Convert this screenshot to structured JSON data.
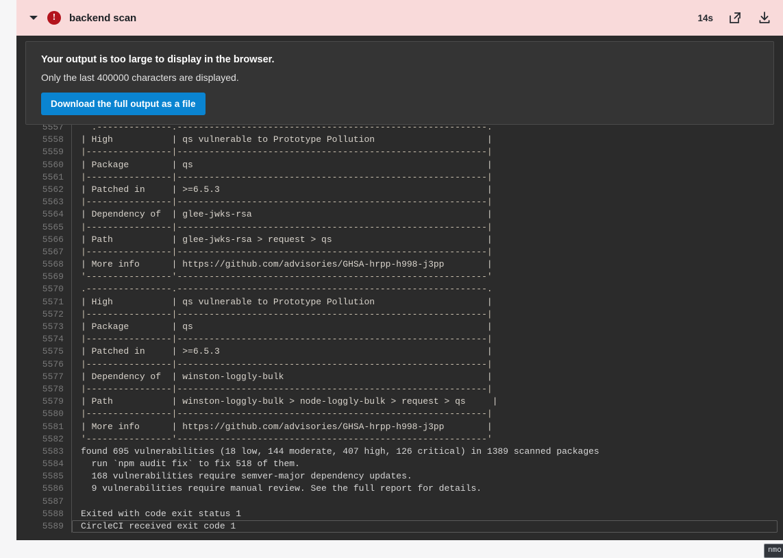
{
  "header": {
    "title": "backend scan",
    "status": "failed",
    "error_icon": "error-exclamation-icon",
    "collapse_icon": "chevron-down-icon",
    "duration": "14s",
    "open_in_new_icon": "external-link-icon",
    "download_icon": "download-icon",
    "background_color": "#f9dada",
    "error_color": "#b3141d"
  },
  "notice": {
    "title": "Your output is too large to display in the browser.",
    "subtitle": "Only the last 400000 characters are displayed.",
    "button_label": "Download the full output as a file",
    "button_color": "#0a84d1"
  },
  "terminal": {
    "background_color": "#2b2b2b",
    "text_color": "#d6d6d6",
    "line_number_color": "#787878",
    "lines": [
      {
        "n": "5557",
        "text": "  .--------------.----------------------------------------------------------.",
        "kind": "rule",
        "clipped": true
      },
      {
        "n": "5558",
        "text": "| High           | qs vulnerable to Prototype Pollution                     |",
        "kind": "cell"
      },
      {
        "n": "5559",
        "text": "|----------------|----------------------------------------------------------|",
        "kind": "rule"
      },
      {
        "n": "5560",
        "text": "| Package        | qs                                                       |",
        "kind": "cell"
      },
      {
        "n": "5561",
        "text": "|----------------|----------------------------------------------------------|",
        "kind": "rule"
      },
      {
        "n": "5562",
        "text": "| Patched in     | >=6.5.3                                                  |",
        "kind": "cell"
      },
      {
        "n": "5563",
        "text": "|----------------|----------------------------------------------------------|",
        "kind": "rule"
      },
      {
        "n": "5564",
        "text": "| Dependency of  | glee-jwks-rsa                                            |",
        "kind": "cell"
      },
      {
        "n": "5565",
        "text": "|----------------|----------------------------------------------------------|",
        "kind": "rule"
      },
      {
        "n": "5566",
        "text": "| Path           | glee-jwks-rsa > request > qs                             |",
        "kind": "cell"
      },
      {
        "n": "5567",
        "text": "|----------------|----------------------------------------------------------|",
        "kind": "rule"
      },
      {
        "n": "5568",
        "text": "| More info      | https://github.com/advisories/GHSA-hrpp-h998-j3pp        |",
        "kind": "cell"
      },
      {
        "n": "5569",
        "text": "'----------------'----------------------------------------------------------'",
        "kind": "rule"
      },
      {
        "n": "5570",
        "text": ".----------------.----------------------------------------------------------.",
        "kind": "rule"
      },
      {
        "n": "5571",
        "text": "| High           | qs vulnerable to Prototype Pollution                     |",
        "kind": "cell"
      },
      {
        "n": "5572",
        "text": "|----------------|----------------------------------------------------------|",
        "kind": "rule"
      },
      {
        "n": "5573",
        "text": "| Package        | qs                                                       |",
        "kind": "cell"
      },
      {
        "n": "5574",
        "text": "|----------------|----------------------------------------------------------|",
        "kind": "rule"
      },
      {
        "n": "5575",
        "text": "| Patched in     | >=6.5.3                                                  |",
        "kind": "cell"
      },
      {
        "n": "5576",
        "text": "|----------------|----------------------------------------------------------|",
        "kind": "rule"
      },
      {
        "n": "5577",
        "text": "| Dependency of  | winston-loggly-bulk                                      |",
        "kind": "cell"
      },
      {
        "n": "5578",
        "text": "|----------------|----------------------------------------------------------|",
        "kind": "rule"
      },
      {
        "n": "5579",
        "text": "| Path           | winston-loggly-bulk > node-loggly-bulk > request > qs     |",
        "kind": "cell"
      },
      {
        "n": "5580",
        "text": "|----------------|----------------------------------------------------------|",
        "kind": "rule"
      },
      {
        "n": "5581",
        "text": "| More info      | https://github.com/advisories/GHSA-hrpp-h998-j3pp        |",
        "kind": "cell"
      },
      {
        "n": "5582",
        "text": "'----------------'----------------------------------------------------------'",
        "kind": "rule"
      },
      {
        "n": "5583",
        "text": "found 695 vulnerabilities (18 low, 144 moderate, 407 high, 126 critical) in 1389 scanned packages",
        "kind": "plain"
      },
      {
        "n": "5584",
        "text": "  run `npm audit fix` to fix 518 of them.",
        "kind": "plain"
      },
      {
        "n": "5585",
        "text": "  168 vulnerabilities require semver-major dependency updates.",
        "kind": "plain"
      },
      {
        "n": "5586",
        "text": "  9 vulnerabilities require manual review. See the full report for details.",
        "kind": "plain"
      },
      {
        "n": "5587",
        "text": "",
        "kind": "plain"
      },
      {
        "n": "5588",
        "text": "Exited with code exit status 1",
        "kind": "plain"
      },
      {
        "n": "5589",
        "text": "CircleCI received exit code 1",
        "kind": "boxed"
      }
    ]
  },
  "audit_summary": {
    "total_vulnerabilities": 695,
    "low": 18,
    "moderate": 144,
    "high": 407,
    "critical": 126,
    "scanned_packages": 1389,
    "auto_fixable": 518,
    "semver_major_updates": 168,
    "manual_review": 9,
    "exit_code": 1
  },
  "tooltip": {
    "text": "nmo"
  }
}
